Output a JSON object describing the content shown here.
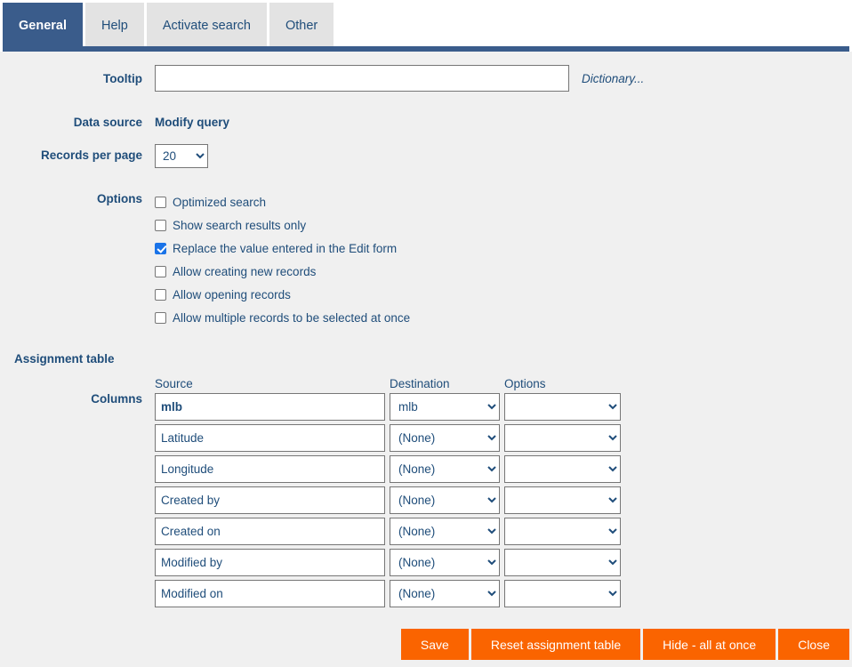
{
  "tabs": [
    {
      "label": "General",
      "active": true
    },
    {
      "label": "Help",
      "active": false
    },
    {
      "label": "Activate search",
      "active": false
    },
    {
      "label": "Other",
      "active": false
    }
  ],
  "form": {
    "tooltip_label": "Tooltip",
    "tooltip_value": "",
    "tooltip_placeholder": "",
    "dictionary_link": "Dictionary...",
    "data_source_label": "Data source",
    "data_source_link": "Modify query",
    "records_label": "Records per page",
    "records_value": "20",
    "records_options": [
      "20"
    ],
    "options_label": "Options",
    "options": [
      {
        "label": "Optimized search",
        "checked": false
      },
      {
        "label": "Show search results only",
        "checked": false
      },
      {
        "label": "Replace the value entered in the Edit form",
        "checked": true
      },
      {
        "label": "Allow creating new records",
        "checked": false
      },
      {
        "label": "Allow opening records",
        "checked": false
      },
      {
        "label": "Allow multiple records to be selected at once",
        "checked": false
      }
    ]
  },
  "assignment": {
    "heading": "Assignment table",
    "columns_label": "Columns",
    "headers": {
      "source": "Source",
      "destination": "Destination",
      "options": "Options"
    },
    "rows": [
      {
        "source": "mlb",
        "source_bold": true,
        "destination": "mlb",
        "options": ""
      },
      {
        "source": "Latitude",
        "source_bold": false,
        "destination": "(None)",
        "options": ""
      },
      {
        "source": "Longitude",
        "source_bold": false,
        "destination": "(None)",
        "options": ""
      },
      {
        "source": "Created by",
        "source_bold": false,
        "destination": "(None)",
        "options": ""
      },
      {
        "source": "Created on",
        "source_bold": false,
        "destination": "(None)",
        "options": ""
      },
      {
        "source": "Modified by",
        "source_bold": false,
        "destination": "(None)",
        "options": ""
      },
      {
        "source": "Modified on",
        "source_bold": false,
        "destination": "(None)",
        "options": ""
      }
    ]
  },
  "buttons": [
    {
      "label": "Save"
    },
    {
      "label": "Reset assignment table"
    },
    {
      "label": "Hide - all at once"
    },
    {
      "label": "Close"
    }
  ],
  "colors": {
    "tab_active": "#3a5c8b",
    "tab_inactive": "#e3e3e3",
    "text": "#1f4d7a",
    "button": "#fa6400",
    "panel_bg": "#f0f0f0",
    "checkbox_on": "#1a73e8"
  }
}
